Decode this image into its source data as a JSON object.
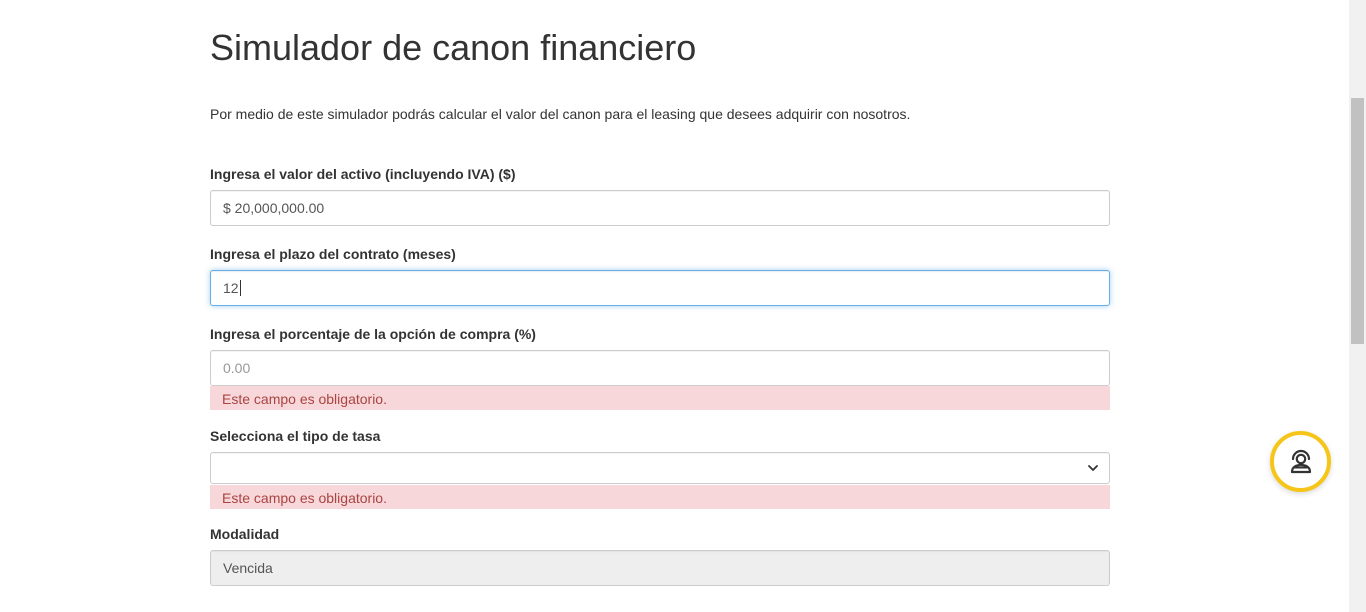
{
  "page": {
    "title": "Simulador de canon financiero",
    "intro": "Por medio de este simulador podrás calcular el valor del canon para el leasing que desees adquirir con nosotros."
  },
  "form": {
    "asset_value": {
      "label": "Ingresa el valor del activo (incluyendo IVA) ($)",
      "value": "$ 20,000,000.00"
    },
    "term": {
      "label": "Ingresa el plazo del contrato (meses)",
      "value": "12"
    },
    "purchase_option": {
      "label": "Ingresa el porcentaje de la opción de compra (%)",
      "placeholder": "0.00",
      "error": "Este campo es obligatorio."
    },
    "rate_type": {
      "label": "Selecciona el tipo de tasa",
      "value": "",
      "error": "Este campo es obligatorio."
    },
    "modality": {
      "label": "Modalidad",
      "value": "Vencida"
    }
  },
  "colors": {
    "focus_border": "#66afe9",
    "error_bg": "#f8d7da",
    "error_text": "#a94442",
    "help_ring": "#f5c518"
  },
  "icons": {
    "help": "support-agent-icon",
    "select": "chevron-down-icon"
  }
}
